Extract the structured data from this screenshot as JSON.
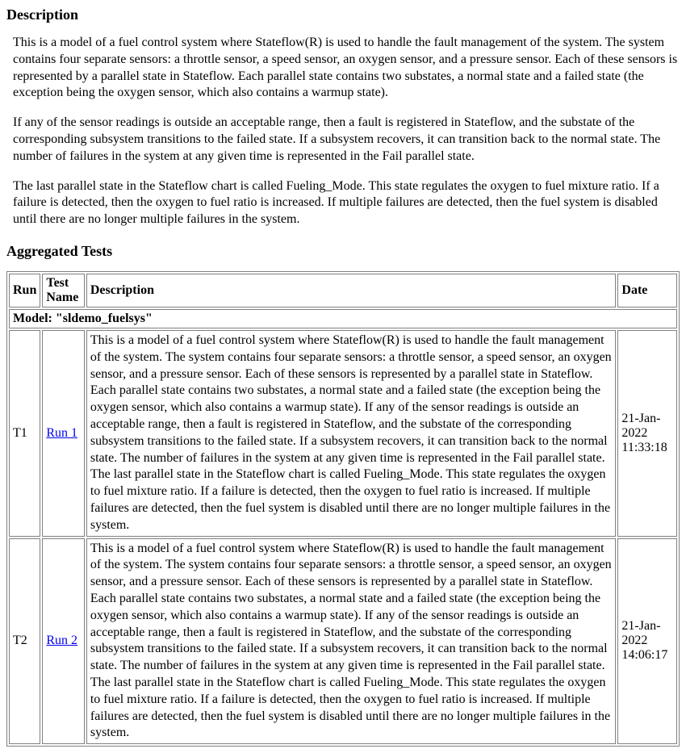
{
  "headings": {
    "description": "Description",
    "aggregated": "Aggregated Tests"
  },
  "description_paragraphs": [
    "This is a model of a fuel control system where Stateflow(R) is used to handle the fault management of the system. The system contains four separate sensors: a throttle sensor, a speed sensor, an oxygen sensor, and a pressure sensor. Each of these sensors is represented by a parallel state in Stateflow.  Each parallel state contains two substates, a normal state and a failed state (the exception being the oxygen sensor, which also contains a warmup state).",
    "If any of the sensor readings is outside an acceptable range, then a fault is registered in Stateflow, and the substate of the corresponding subsystem transitions to the failed state.  If a subsystem recovers, it can transition back to the normal state.  The number of failures in the system at any given time is represented in the Fail parallel state.",
    "The last parallel state in the Stateflow chart is called Fueling_Mode.  This state regulates the oxygen to fuel mixture ratio.  If a failure is detected, then the oxygen to fuel ratio is increased.  If multiple failures are detected, then the fuel system is disabled until there are no longer multiple failures in the system."
  ],
  "table": {
    "headers": {
      "run": "Run",
      "test_name": "Test Name",
      "description": "Description",
      "date": "Date"
    },
    "model_row": "Model: \"sldemo_fuelsys\"",
    "rows": [
      {
        "run": "T1",
        "test_name": "Run 1",
        "description": "This is a model of a fuel control system where Stateflow(R) is used to handle the fault management of the system. The system contains four separate sensors: a throttle sensor, a speed sensor, an oxygen sensor, and a pressure sensor. Each of these sensors is represented by a parallel state in Stateflow. Each parallel state contains two substates, a normal state and a failed state (the exception being the oxygen sensor, which also contains a warmup state). If any of the sensor readings is outside an acceptable range, then a fault is registered in Stateflow, and the substate of the corresponding subsystem transitions to the failed state. If a subsystem recovers, it can transition back to the normal state. The number of failures in the system at any given time is represented in the Fail parallel state. The last parallel state in the Stateflow chart is called Fueling_Mode. This state regulates the oxygen to fuel mixture ratio. If a failure is detected, then the oxygen to fuel ratio is increased. If multiple failures are detected, then the fuel system is disabled until there are no longer multiple failures in the system.",
        "date": "21-Jan-2022 11:33:18"
      },
      {
        "run": "T2",
        "test_name": "Run 2",
        "description": "This is a model of a fuel control system where Stateflow(R) is used to handle the fault management of the system. The system contains four separate sensors: a throttle sensor, a speed sensor, an oxygen sensor, and a pressure sensor. Each of these sensors is represented by a parallel state in Stateflow. Each parallel state contains two substates, a normal state and a failed state (the exception being the oxygen sensor, which also contains a warmup state). If any of the sensor readings is outside an acceptable range, then a fault is registered in Stateflow, and the substate of the corresponding subsystem transitions to the failed state. If a subsystem recovers, it can transition back to the normal state. The number of failures in the system at any given time is represented in the Fail parallel state. The last parallel state in the Stateflow chart is called Fueling_Mode. This state regulates the oxygen to fuel mixture ratio. If a failure is detected, then the oxygen to fuel ratio is increased. If multiple failures are detected, then the fuel system is disabled until there are no longer multiple failures in the system.",
        "date": "21-Jan-2022 14:06:17"
      }
    ]
  }
}
